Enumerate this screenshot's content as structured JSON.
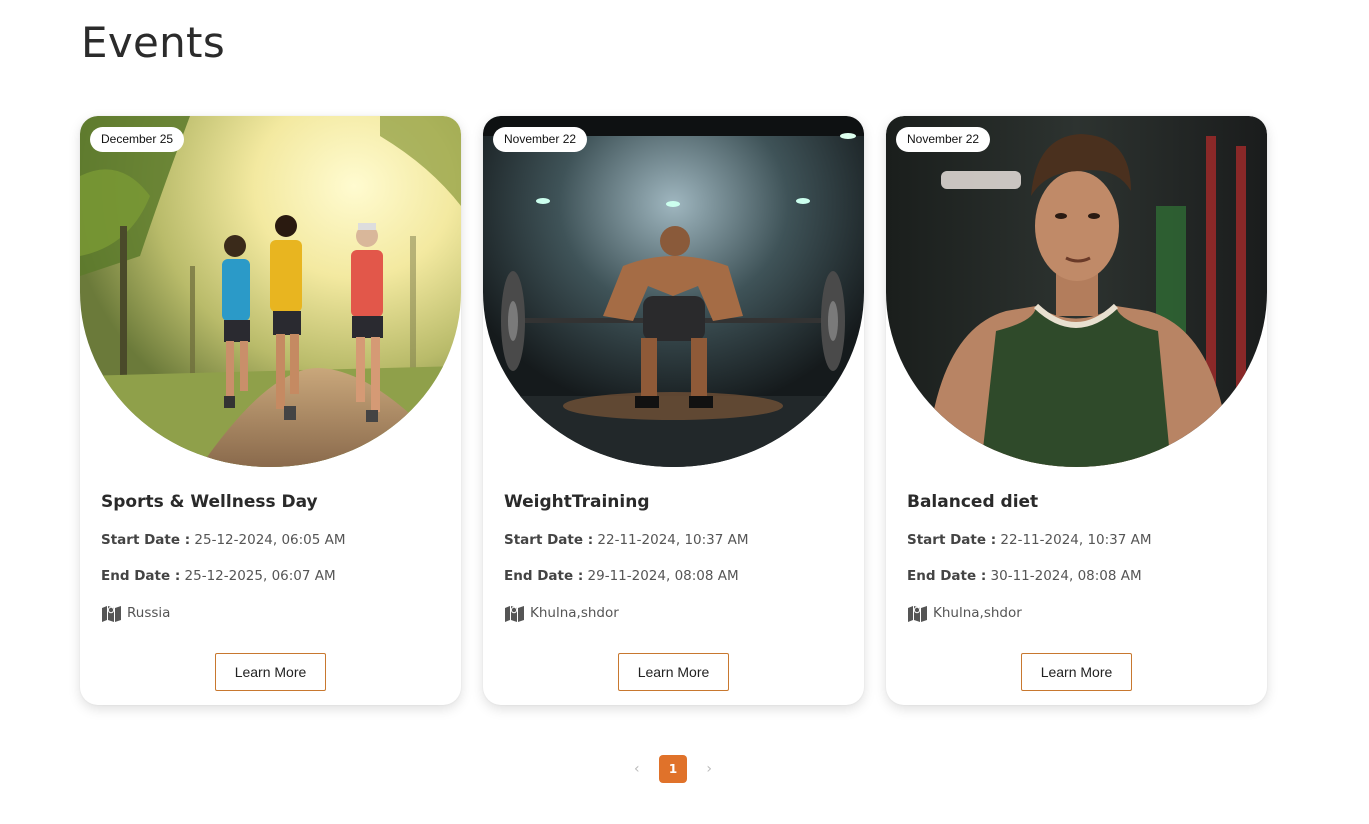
{
  "page": {
    "title": "Events"
  },
  "events": [
    {
      "date_badge": "December 25",
      "title": "Sports & Wellness Day",
      "start_label": "Start Date :",
      "start_value": " 25-12-2024, 06:05 AM",
      "end_label": "End Date :",
      "end_value": " 25-12-2025, 06:07 AM",
      "location": "Russia",
      "button_label": "Learn More",
      "image": "three-runners-in-park"
    },
    {
      "date_badge": "November 22",
      "title": "WeightTraining",
      "start_label": "Start Date :",
      "start_value": " 22-11-2024, 10:37 AM",
      "end_label": "End Date :",
      "end_value": " 29-11-2024, 08:08 AM",
      "location": "Khulna,shdor",
      "button_label": "Learn More",
      "image": "weightlifter-deadlift-gym"
    },
    {
      "date_badge": "November 22",
      "title": "Balanced diet",
      "start_label": "Start Date :",
      "start_value": " 22-11-2024, 10:37 AM",
      "end_label": "End Date :",
      "end_value": " 30-11-2024, 08:08 AM",
      "location": "Khulna,shdor",
      "button_label": "Learn More",
      "image": "man-portrait-gym"
    }
  ],
  "pagination": {
    "prev": "‹",
    "current": "1",
    "next": "›"
  },
  "colors": {
    "accent": "#e0722a",
    "button_border": "#c8782f"
  }
}
